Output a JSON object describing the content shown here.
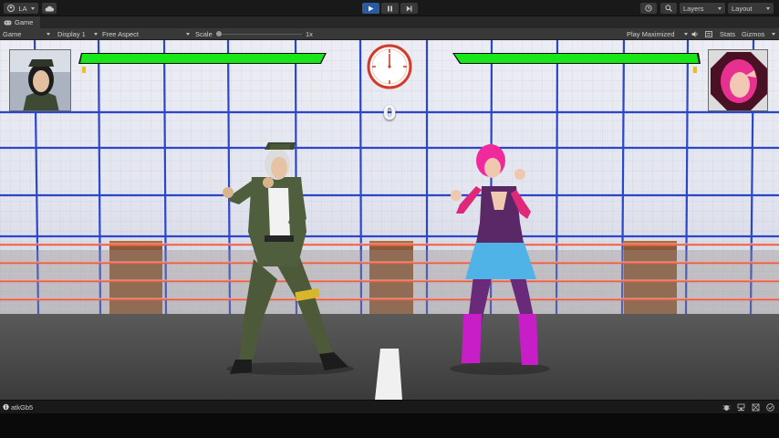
{
  "toolbar": {
    "account_label": "LA",
    "account_icon": "account-icon",
    "cloud_icon": "cloud-icon",
    "play_icon": "play-icon",
    "pause_icon": "pause-icon",
    "step_icon": "step-icon",
    "history_icon": "history-icon",
    "search_icon": "search-icon",
    "layers_label": "Layers",
    "layout_label": "Layout",
    "accent_color": "#2a5aa0"
  },
  "tab": {
    "label": "Game",
    "icon": "game-controller-icon"
  },
  "viewbar": {
    "mode": "Game",
    "display": "Display 1",
    "aspect": "Free Aspect",
    "scale_label": "Scale",
    "scale_value": "1x",
    "play_mode": "Play Maximized",
    "mute_icon": "speaker-icon",
    "stats_label": "Stats",
    "gizmos_label": "Gizmos"
  },
  "hud": {
    "timer_value": "0",
    "player1_health": 1.0,
    "player2_health": 1.0,
    "health_color": "#19e619",
    "player1_portrait": "female-soldier-portrait",
    "player2_portrait": "pink-hair-fighter-portrait"
  },
  "status": {
    "message": "atkGb5"
  }
}
